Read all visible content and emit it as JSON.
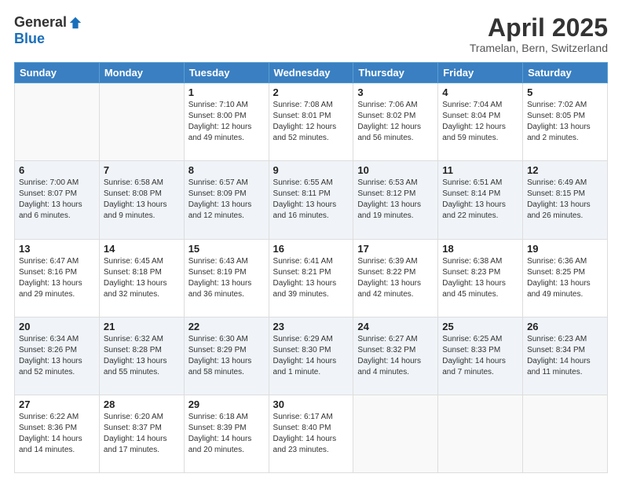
{
  "logo": {
    "general": "General",
    "blue": "Blue"
  },
  "header": {
    "title": "April 2025",
    "subtitle": "Tramelan, Bern, Switzerland"
  },
  "weekdays": [
    "Sunday",
    "Monday",
    "Tuesday",
    "Wednesday",
    "Thursday",
    "Friday",
    "Saturday"
  ],
  "weeks": [
    [
      {
        "day": "",
        "info": ""
      },
      {
        "day": "",
        "info": ""
      },
      {
        "day": "1",
        "info": "Sunrise: 7:10 AM\nSunset: 8:00 PM\nDaylight: 12 hours\nand 49 minutes."
      },
      {
        "day": "2",
        "info": "Sunrise: 7:08 AM\nSunset: 8:01 PM\nDaylight: 12 hours\nand 52 minutes."
      },
      {
        "day": "3",
        "info": "Sunrise: 7:06 AM\nSunset: 8:02 PM\nDaylight: 12 hours\nand 56 minutes."
      },
      {
        "day": "4",
        "info": "Sunrise: 7:04 AM\nSunset: 8:04 PM\nDaylight: 12 hours\nand 59 minutes."
      },
      {
        "day": "5",
        "info": "Sunrise: 7:02 AM\nSunset: 8:05 PM\nDaylight: 13 hours\nand 2 minutes."
      }
    ],
    [
      {
        "day": "6",
        "info": "Sunrise: 7:00 AM\nSunset: 8:07 PM\nDaylight: 13 hours\nand 6 minutes."
      },
      {
        "day": "7",
        "info": "Sunrise: 6:58 AM\nSunset: 8:08 PM\nDaylight: 13 hours\nand 9 minutes."
      },
      {
        "day": "8",
        "info": "Sunrise: 6:57 AM\nSunset: 8:09 PM\nDaylight: 13 hours\nand 12 minutes."
      },
      {
        "day": "9",
        "info": "Sunrise: 6:55 AM\nSunset: 8:11 PM\nDaylight: 13 hours\nand 16 minutes."
      },
      {
        "day": "10",
        "info": "Sunrise: 6:53 AM\nSunset: 8:12 PM\nDaylight: 13 hours\nand 19 minutes."
      },
      {
        "day": "11",
        "info": "Sunrise: 6:51 AM\nSunset: 8:14 PM\nDaylight: 13 hours\nand 22 minutes."
      },
      {
        "day": "12",
        "info": "Sunrise: 6:49 AM\nSunset: 8:15 PM\nDaylight: 13 hours\nand 26 minutes."
      }
    ],
    [
      {
        "day": "13",
        "info": "Sunrise: 6:47 AM\nSunset: 8:16 PM\nDaylight: 13 hours\nand 29 minutes."
      },
      {
        "day": "14",
        "info": "Sunrise: 6:45 AM\nSunset: 8:18 PM\nDaylight: 13 hours\nand 32 minutes."
      },
      {
        "day": "15",
        "info": "Sunrise: 6:43 AM\nSunset: 8:19 PM\nDaylight: 13 hours\nand 36 minutes."
      },
      {
        "day": "16",
        "info": "Sunrise: 6:41 AM\nSunset: 8:21 PM\nDaylight: 13 hours\nand 39 minutes."
      },
      {
        "day": "17",
        "info": "Sunrise: 6:39 AM\nSunset: 8:22 PM\nDaylight: 13 hours\nand 42 minutes."
      },
      {
        "day": "18",
        "info": "Sunrise: 6:38 AM\nSunset: 8:23 PM\nDaylight: 13 hours\nand 45 minutes."
      },
      {
        "day": "19",
        "info": "Sunrise: 6:36 AM\nSunset: 8:25 PM\nDaylight: 13 hours\nand 49 minutes."
      }
    ],
    [
      {
        "day": "20",
        "info": "Sunrise: 6:34 AM\nSunset: 8:26 PM\nDaylight: 13 hours\nand 52 minutes."
      },
      {
        "day": "21",
        "info": "Sunrise: 6:32 AM\nSunset: 8:28 PM\nDaylight: 13 hours\nand 55 minutes."
      },
      {
        "day": "22",
        "info": "Sunrise: 6:30 AM\nSunset: 8:29 PM\nDaylight: 13 hours\nand 58 minutes."
      },
      {
        "day": "23",
        "info": "Sunrise: 6:29 AM\nSunset: 8:30 PM\nDaylight: 14 hours\nand 1 minute."
      },
      {
        "day": "24",
        "info": "Sunrise: 6:27 AM\nSunset: 8:32 PM\nDaylight: 14 hours\nand 4 minutes."
      },
      {
        "day": "25",
        "info": "Sunrise: 6:25 AM\nSunset: 8:33 PM\nDaylight: 14 hours\nand 7 minutes."
      },
      {
        "day": "26",
        "info": "Sunrise: 6:23 AM\nSunset: 8:34 PM\nDaylight: 14 hours\nand 11 minutes."
      }
    ],
    [
      {
        "day": "27",
        "info": "Sunrise: 6:22 AM\nSunset: 8:36 PM\nDaylight: 14 hours\nand 14 minutes."
      },
      {
        "day": "28",
        "info": "Sunrise: 6:20 AM\nSunset: 8:37 PM\nDaylight: 14 hours\nand 17 minutes."
      },
      {
        "day": "29",
        "info": "Sunrise: 6:18 AM\nSunset: 8:39 PM\nDaylight: 14 hours\nand 20 minutes."
      },
      {
        "day": "30",
        "info": "Sunrise: 6:17 AM\nSunset: 8:40 PM\nDaylight: 14 hours\nand 23 minutes."
      },
      {
        "day": "",
        "info": ""
      },
      {
        "day": "",
        "info": ""
      },
      {
        "day": "",
        "info": ""
      }
    ]
  ]
}
